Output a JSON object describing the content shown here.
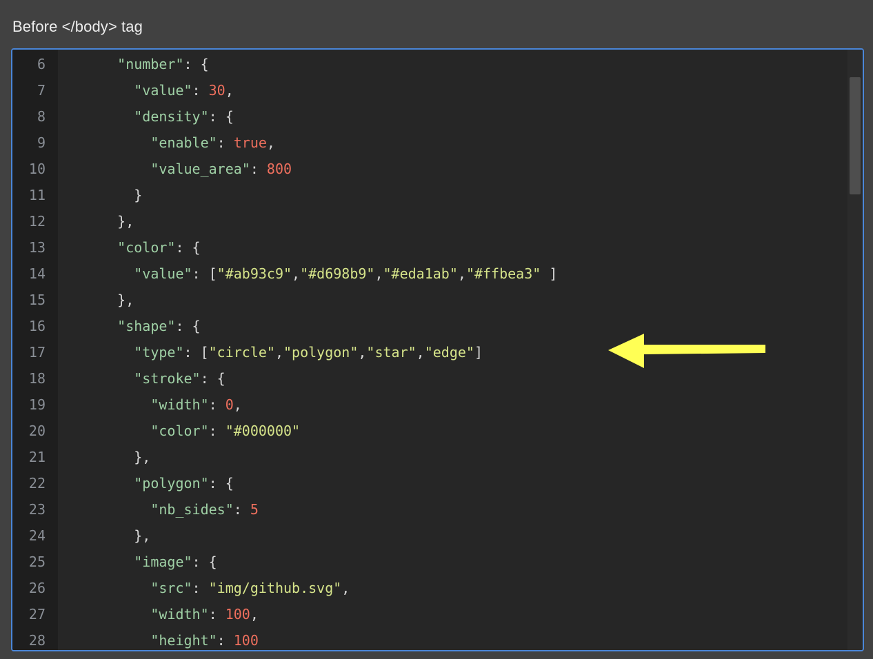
{
  "section_label": "Before </body> tag",
  "colors": {
    "accent_border": "#4a86d8",
    "key": "#9fd0a5",
    "string": "#d6e48a",
    "number": "#ee6f5d",
    "arrow": "#ffff55"
  },
  "annotation_icon": "yellow-arrow-left-icon",
  "code_lines": [
    {
      "num": "6",
      "tokens": [
        {
          "t": "    "
        },
        {
          "t": "\"number\"",
          "c": "key"
        },
        {
          "t": ": {"
        }
      ]
    },
    {
      "num": "7",
      "tokens": [
        {
          "t": "      "
        },
        {
          "t": "\"value\"",
          "c": "key"
        },
        {
          "t": ": "
        },
        {
          "t": "30",
          "c": "num"
        },
        {
          "t": ","
        }
      ]
    },
    {
      "num": "8",
      "tokens": [
        {
          "t": "      "
        },
        {
          "t": "\"density\"",
          "c": "key"
        },
        {
          "t": ": {"
        }
      ]
    },
    {
      "num": "9",
      "tokens": [
        {
          "t": "        "
        },
        {
          "t": "\"enable\"",
          "c": "key"
        },
        {
          "t": ": "
        },
        {
          "t": "true",
          "c": "bool"
        },
        {
          "t": ","
        }
      ]
    },
    {
      "num": "10",
      "tokens": [
        {
          "t": "        "
        },
        {
          "t": "\"value_area\"",
          "c": "key"
        },
        {
          "t": ": "
        },
        {
          "t": "800",
          "c": "num"
        }
      ]
    },
    {
      "num": "11",
      "tokens": [
        {
          "t": "      }"
        }
      ]
    },
    {
      "num": "12",
      "tokens": [
        {
          "t": "    },"
        }
      ]
    },
    {
      "num": "13",
      "tokens": [
        {
          "t": "    "
        },
        {
          "t": "\"color\"",
          "c": "key"
        },
        {
          "t": ": {"
        }
      ]
    },
    {
      "num": "14",
      "tokens": [
        {
          "t": "      "
        },
        {
          "t": "\"value\"",
          "c": "key"
        },
        {
          "t": ": ["
        },
        {
          "t": "\"#ab93c9\"",
          "c": "str"
        },
        {
          "t": ","
        },
        {
          "t": "\"#d698b9\"",
          "c": "str"
        },
        {
          "t": ","
        },
        {
          "t": "\"#eda1ab\"",
          "c": "str"
        },
        {
          "t": ","
        },
        {
          "t": "\"#ffbea3\"",
          "c": "str"
        },
        {
          "t": " ]"
        }
      ]
    },
    {
      "num": "15",
      "tokens": [
        {
          "t": "    },"
        }
      ]
    },
    {
      "num": "16",
      "tokens": [
        {
          "t": "    "
        },
        {
          "t": "\"shape\"",
          "c": "key"
        },
        {
          "t": ": {"
        }
      ]
    },
    {
      "num": "17",
      "tokens": [
        {
          "t": "      "
        },
        {
          "t": "\"type\"",
          "c": "key"
        },
        {
          "t": ": ["
        },
        {
          "t": "\"circle\"",
          "c": "str"
        },
        {
          "t": ","
        },
        {
          "t": "\"polygon\"",
          "c": "str"
        },
        {
          "t": ","
        },
        {
          "t": "\"star\"",
          "c": "str"
        },
        {
          "t": ","
        },
        {
          "t": "\"edge\"",
          "c": "str"
        },
        {
          "t": "]"
        }
      ]
    },
    {
      "num": "18",
      "tokens": [
        {
          "t": "      "
        },
        {
          "t": "\"stroke\"",
          "c": "key"
        },
        {
          "t": ": {"
        }
      ]
    },
    {
      "num": "19",
      "tokens": [
        {
          "t": "        "
        },
        {
          "t": "\"width\"",
          "c": "key"
        },
        {
          "t": ": "
        },
        {
          "t": "0",
          "c": "num"
        },
        {
          "t": ","
        }
      ]
    },
    {
      "num": "20",
      "tokens": [
        {
          "t": "        "
        },
        {
          "t": "\"color\"",
          "c": "key"
        },
        {
          "t": ": "
        },
        {
          "t": "\"#000000\"",
          "c": "str"
        }
      ]
    },
    {
      "num": "21",
      "tokens": [
        {
          "t": "      },"
        }
      ]
    },
    {
      "num": "22",
      "tokens": [
        {
          "t": "      "
        },
        {
          "t": "\"polygon\"",
          "c": "key"
        },
        {
          "t": ": {"
        }
      ]
    },
    {
      "num": "23",
      "tokens": [
        {
          "t": "        "
        },
        {
          "t": "\"nb_sides\"",
          "c": "key"
        },
        {
          "t": ": "
        },
        {
          "t": "5",
          "c": "num"
        }
      ]
    },
    {
      "num": "24",
      "tokens": [
        {
          "t": "      },"
        }
      ]
    },
    {
      "num": "25",
      "tokens": [
        {
          "t": "      "
        },
        {
          "t": "\"image\"",
          "c": "key"
        },
        {
          "t": ": {"
        }
      ]
    },
    {
      "num": "26",
      "tokens": [
        {
          "t": "        "
        },
        {
          "t": "\"src\"",
          "c": "key"
        },
        {
          "t": ": "
        },
        {
          "t": "\"img/github.svg\"",
          "c": "str"
        },
        {
          "t": ","
        }
      ]
    },
    {
      "num": "27",
      "tokens": [
        {
          "t": "        "
        },
        {
          "t": "\"width\"",
          "c": "key"
        },
        {
          "t": ": "
        },
        {
          "t": "100",
          "c": "num"
        },
        {
          "t": ","
        }
      ]
    },
    {
      "num": "28",
      "tokens": [
        {
          "t": "        "
        },
        {
          "t": "\"height\"",
          "c": "key"
        },
        {
          "t": ": "
        },
        {
          "t": "100",
          "c": "num"
        }
      ]
    }
  ]
}
